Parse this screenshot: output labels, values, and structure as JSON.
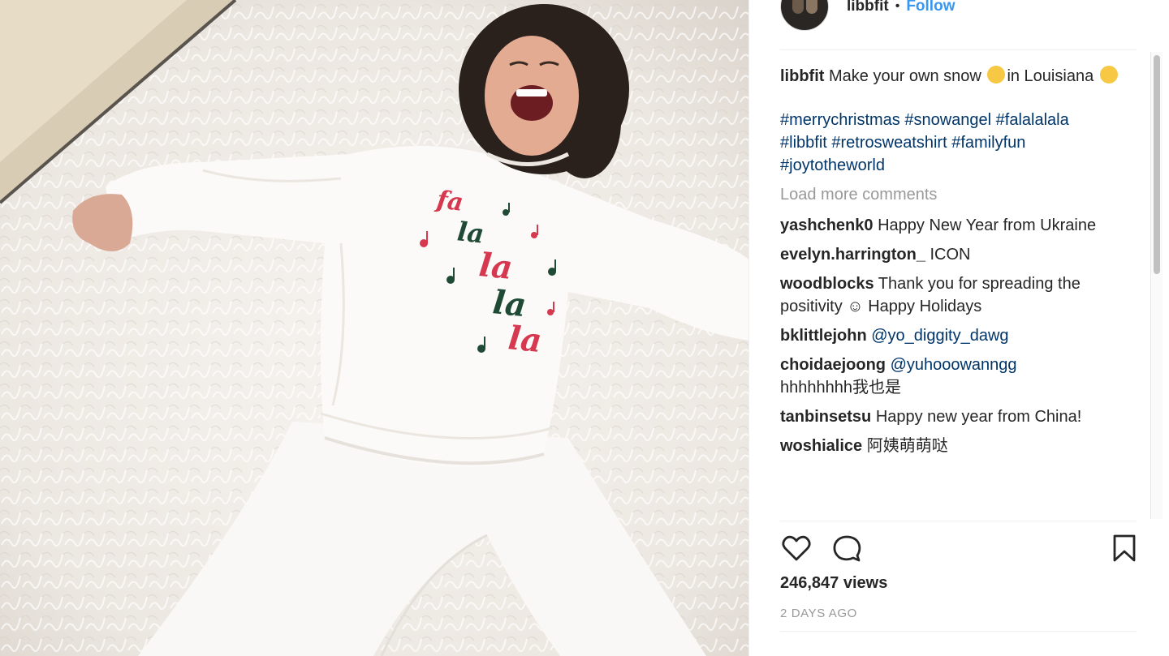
{
  "post": {
    "username": "libbfit",
    "separator": "•",
    "follow_label": "Follow",
    "caption_text": "Make your own snow",
    "caption_text2": "in Louisiana",
    "hashtags": [
      "#merrychristmas",
      "#snowangel",
      "#falalalala",
      "#libbfit",
      "#retrosweatshirt",
      "#familyfun",
      "#joytotheworld"
    ],
    "load_more_label": "Load more comments",
    "views": "246,847 views",
    "age": "2 DAYS AGO"
  },
  "comments": [
    {
      "user": "yashchenk0",
      "text": "Happy New Year from Ukraine"
    },
    {
      "user": "evelyn.harrington_",
      "text": "ICON"
    },
    {
      "user": "woodblocks",
      "text": "Thank you for spreading the positivity ☺ Happy Holidays"
    },
    {
      "user": "bklittlejohn",
      "mention": "@yo_diggity_dawg"
    },
    {
      "user": "choidaejoong",
      "mention": "@yuhooowanngg",
      "text": "hhhhhhhh我也是"
    },
    {
      "user": "tanbinsetsu",
      "text": "Happy new year from China!"
    },
    {
      "user": "woshialice",
      "text": "阿姨萌萌哒"
    }
  ],
  "sweatshirt_text": [
    "fa",
    "la",
    "la",
    "la",
    "la"
  ],
  "icons": {
    "like": "heart-icon",
    "comment": "comment-icon",
    "save": "bookmark-icon"
  },
  "colors": {
    "link": "#003569",
    "follow": "#3897f0",
    "muted": "#999999",
    "text": "#262626",
    "sweatshirt_red": "#d5384f",
    "sweatshirt_green": "#1f4a36"
  }
}
